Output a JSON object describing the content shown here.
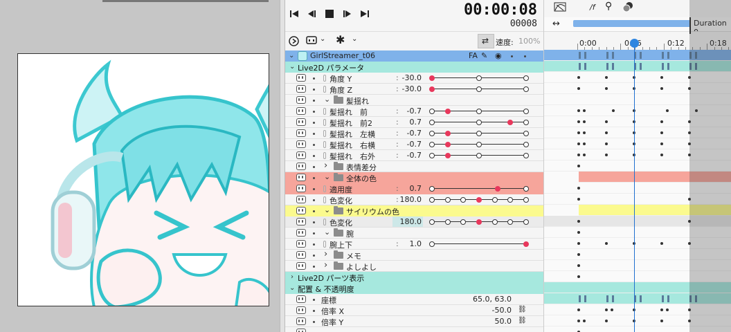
{
  "transport": {
    "timecode": "00:00:08",
    "frame": "00008",
    "speed_label": "速度:",
    "speed_value": "100%"
  },
  "timeline": {
    "duration_label": "Duration 0",
    "ticks": [
      "0:00",
      "0:06",
      "0:12",
      "0:18"
    ],
    "fps_icon_label": "/f"
  },
  "layer": {
    "name": "GirlStreamer_t06",
    "badge": "FA"
  },
  "groups": {
    "live2d_params": "Live2D パラメータ",
    "live2d_parts": "Live2D パーツ表示",
    "placement": "配置 & 不透明度"
  },
  "params": [
    {
      "label": "角度 Y",
      "value": "-30.0",
      "knobs": [
        0,
        0.5,
        1
      ],
      "on": 0
    },
    {
      "label": "角度 Z",
      "value": "-30.0",
      "knobs": [
        0,
        0.5,
        1
      ],
      "on": 0
    },
    {
      "label": "髪揺れ",
      "folder": true
    },
    {
      "label": "髪揺れ　前",
      "value": "-0.7",
      "knobs": [
        0,
        0.17,
        0.5,
        1
      ],
      "on": 1
    },
    {
      "label": "髪揺れ　前2",
      "value": "0.7",
      "knobs": [
        0,
        0.5,
        0.83,
        1
      ],
      "on": 2
    },
    {
      "label": "髪揺れ　左横",
      "value": "-0.7",
      "knobs": [
        0,
        0.17,
        0.5,
        1
      ],
      "on": 1
    },
    {
      "label": "髪揺れ　右横",
      "value": "-0.7",
      "knobs": [
        0,
        0.17,
        0.5,
        1
      ],
      "on": 1
    },
    {
      "label": "髪揺れ　右外",
      "value": "-0.7",
      "knobs": [
        0,
        0.17,
        0.5,
        1
      ],
      "on": 1
    },
    {
      "label": "表情差分",
      "folder": true
    },
    {
      "label": "全体の色",
      "folder": true
    },
    {
      "label": "適用度",
      "value": "0.7",
      "knobs": [
        0,
        0.7,
        1
      ],
      "on": 1
    },
    {
      "label": "色変化",
      "value": "180.0",
      "knobs": [
        0,
        0.17,
        0.33,
        0.5,
        0.67,
        0.83,
        1
      ],
      "on": 3
    },
    {
      "label": "サイリウムの色",
      "folder": true
    },
    {
      "label": "色変化",
      "value": "180.0",
      "knobs": [
        0,
        0.17,
        0.33,
        0.5,
        0.67,
        0.83,
        1
      ],
      "on": 3
    },
    {
      "label": "腕",
      "folder": true
    },
    {
      "label": "腕上下",
      "value": "1.0",
      "knobs": [
        0,
        1
      ],
      "on": 1
    },
    {
      "label": "メモ",
      "folder": true
    },
    {
      "label": "よしよし",
      "folder": true
    }
  ],
  "placement": [
    {
      "label": "座標",
      "value": "65.0,  63.0"
    },
    {
      "label": "倍率 X",
      "value": "-50.0"
    },
    {
      "label": "倍率 Y",
      "value": "50.0"
    }
  ],
  "colors": {
    "layer_header": "#7fb2ea",
    "group_header": "#a6e8de",
    "red_folder": "#f6a59b",
    "yellow_folder": "#fbfa8e",
    "accent_key": "#e8385c",
    "playhead": "#1e6fd0"
  }
}
